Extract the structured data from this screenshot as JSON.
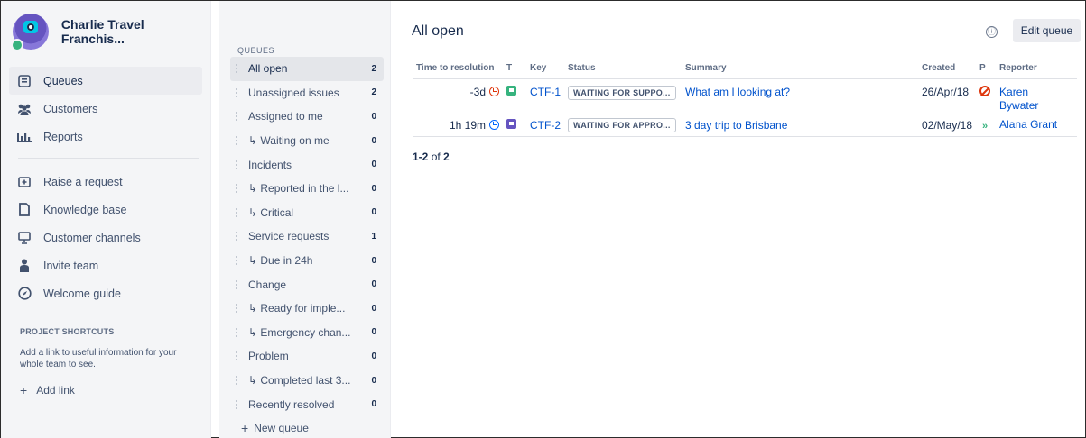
{
  "project": {
    "name": "Charlie Travel Franchis..."
  },
  "sidebar": {
    "primary": [
      {
        "label": "Queues",
        "icon": "queues-icon",
        "active": true
      },
      {
        "label": "Customers",
        "icon": "customers-icon"
      },
      {
        "label": "Reports",
        "icon": "reports-icon"
      }
    ],
    "secondary": [
      {
        "label": "Raise a request",
        "icon": "raise-request-icon"
      },
      {
        "label": "Knowledge base",
        "icon": "knowledge-base-icon"
      },
      {
        "label": "Customer channels",
        "icon": "customer-channels-icon"
      },
      {
        "label": "Invite team",
        "icon": "invite-team-icon"
      },
      {
        "label": "Welcome guide",
        "icon": "compass-icon"
      }
    ],
    "shortcuts": {
      "title": "PROJECT SHORTCUTS",
      "description": "Add a link to useful information for your whole team to see.",
      "add_link": "Add link"
    }
  },
  "queues": {
    "title": "QUEUES",
    "items": [
      {
        "label": "All open",
        "count": "2",
        "active": true
      },
      {
        "label": "Unassigned issues",
        "count": "2"
      },
      {
        "label": "Assigned to me",
        "count": "0"
      },
      {
        "label": "↳ Waiting on me",
        "count": "0"
      },
      {
        "label": "Incidents",
        "count": "0"
      },
      {
        "label": "↳ Reported in the l...",
        "count": "0"
      },
      {
        "label": "↳ Critical",
        "count": "0"
      },
      {
        "label": "Service requests",
        "count": "1"
      },
      {
        "label": "↳ Due in 24h",
        "count": "0"
      },
      {
        "label": "Change",
        "count": "0"
      },
      {
        "label": "↳ Ready for imple...",
        "count": "0"
      },
      {
        "label": "↳ Emergency chan...",
        "count": "0"
      },
      {
        "label": "Problem",
        "count": "0"
      },
      {
        "label": "↳ Completed last 3...",
        "count": "0"
      },
      {
        "label": "Recently resolved",
        "count": "0"
      }
    ],
    "new_queue": "New queue"
  },
  "main": {
    "title": "All open",
    "edit_button": "Edit queue",
    "info_icon": "ⓘ",
    "columns": [
      "Time to resolution",
      "T",
      "Key",
      "Status",
      "Summary",
      "Created",
      "P",
      "Reporter"
    ],
    "rows": [
      {
        "ttr": "-3d",
        "ttr_state": "breached",
        "type": "green",
        "key": "CTF-1",
        "status": "WAITING FOR SUPPO...",
        "summary": "What am I looking at?",
        "created": "26/Apr/18",
        "priority": "blocker",
        "reporter": "Karen Bywater"
      },
      {
        "ttr": "1h 19m",
        "ttr_state": "ongoing",
        "type": "purple",
        "key": "CTF-2",
        "status": "WAITING FOR APPRO...",
        "summary": "3 day trip to Brisbane",
        "created": "02/May/18",
        "priority": "lowest",
        "reporter": "Alana Grant"
      }
    ],
    "pager": {
      "range": "1-2",
      "of": "of",
      "total": "2"
    }
  },
  "colors": {
    "accent": "#0052cc",
    "breached": "#de350b",
    "ongoing": "#0065ff",
    "sidebar_bg": "#f4f5f7"
  }
}
